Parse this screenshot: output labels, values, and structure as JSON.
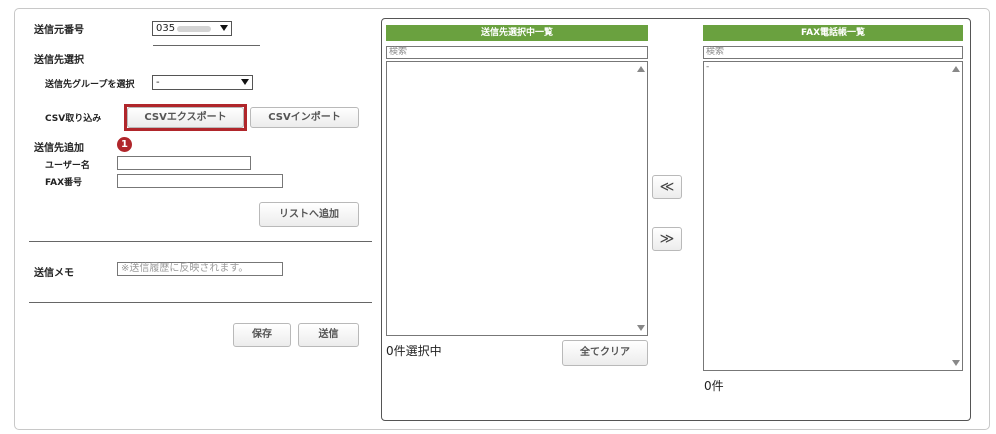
{
  "form": {
    "sender_number_label": "送信元番号",
    "sender_number_value": "035",
    "destination_select_label": "送信先選択",
    "group_select_label": "送信先グループを選択",
    "group_select_value": "-",
    "csv_label": "CSV取り込み",
    "csv_export_label": "CSVエクスポート",
    "csv_import_label": "CSVインポート",
    "add_destination_label": "送信先追加",
    "callout_number": "1",
    "username_label": "ユーザー名",
    "username_value": "",
    "fax_number_label": "FAX番号",
    "fax_number_value": "",
    "add_to_list_label": "リストへ追加",
    "memo_label": "送信メモ",
    "memo_placeholder": "※送信履歴に反映されます。",
    "save_label": "保存",
    "send_label": "送信"
  },
  "selected_list": {
    "title": "送信先選択中一覧",
    "search_placeholder": "検索",
    "count_text": "0件選択中",
    "clear_all_label": "全てクリア"
  },
  "fax_list": {
    "title": "FAX電話帳一覧",
    "search_placeholder": "検索",
    "first_row": "-",
    "count_text": "0件"
  },
  "transfer": {
    "move_left_label": "≪",
    "move_right_label": "≫"
  },
  "colors": {
    "list_header": "#6aa13f",
    "highlight": "#b0262b"
  }
}
